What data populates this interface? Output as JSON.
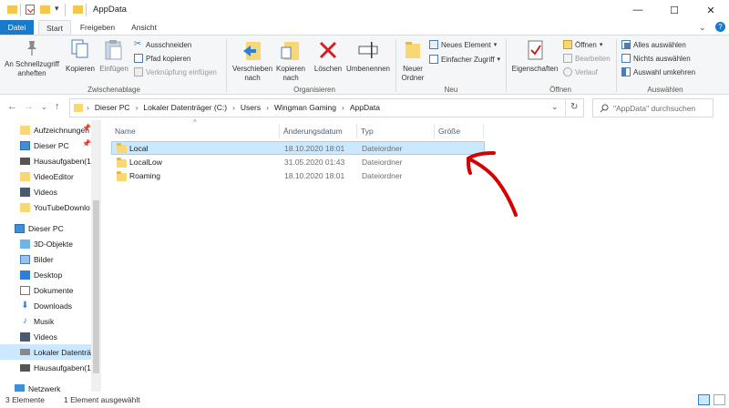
{
  "window": {
    "title": "AppData",
    "minimize": "—",
    "maximize": "☐",
    "close": "✕"
  },
  "ribbon": {
    "tabs": [
      "Datei",
      "Start",
      "Freigeben",
      "Ansicht"
    ],
    "clipboard": {
      "pin_label": "An Schnellzugriff anheften",
      "copy_label": "Kopieren",
      "paste_label": "Einfügen",
      "cut": "Ausschneiden",
      "copy_path": "Pfad kopieren",
      "paste_shortcut": "Verknüpfung einfügen",
      "group_label": "Zwischenablage"
    },
    "organize": {
      "move_label": "Verschieben nach",
      "copyto_label": "Kopieren nach",
      "delete_label": "Löschen",
      "rename_label": "Umbenennen",
      "group_label": "Organisieren"
    },
    "new": {
      "newfolder_label": "Neuer Ordner",
      "newitem": "Neues Element",
      "easyaccess": "Einfacher Zugriff",
      "group_label": "Neu"
    },
    "open": {
      "properties_label": "Eigenschaften",
      "open": "Öffnen",
      "edit": "Bearbeiten",
      "history": "Verlauf",
      "group_label": "Öffnen"
    },
    "select": {
      "select_all": "Alles auswählen",
      "select_none": "Nichts auswählen",
      "invert": "Auswahl umkehren",
      "group_label": "Auswählen"
    }
  },
  "address": {
    "crumbs": [
      "Dieser PC",
      "Lokaler Datenträger (C:)",
      "Users",
      "Wingman Gaming",
      "AppData"
    ],
    "search_placeholder": "\"AppData\" durchsuchen"
  },
  "navpane": {
    "quick": [
      {
        "label": "Aufzeichnungen",
        "pinned": true
      },
      {
        "label": "Dieser PC",
        "pinned": true
      },
      {
        "label": "Hausaufgaben(1",
        "pinned": false
      },
      {
        "label": "VideoEditor",
        "pinned": false
      },
      {
        "label": "Videos",
        "pinned": false
      },
      {
        "label": "YouTubeDownlo",
        "pinned": false
      }
    ],
    "thispc": "Dieser PC",
    "thispc_items": [
      "3D-Objekte",
      "Bilder",
      "Desktop",
      "Dokumente",
      "Downloads",
      "Musik",
      "Videos",
      "Lokaler Datenträ",
      "Hausaufgaben(1"
    ],
    "network": "Netzwerk"
  },
  "filelist": {
    "columns": [
      "Name",
      "Änderungsdatum",
      "Typ",
      "Größe"
    ],
    "rows": [
      {
        "name": "Local",
        "date": "18.10.2020 18:01",
        "type": "Dateiordner",
        "size": "",
        "selected": true
      },
      {
        "name": "LocalLow",
        "date": "31.05.2020 01:43",
        "type": "Dateiordner",
        "size": "",
        "selected": false
      },
      {
        "name": "Roaming",
        "date": "18.10.2020 18:01",
        "type": "Dateiordner",
        "size": "",
        "selected": false
      }
    ]
  },
  "status": {
    "count": "3 Elemente",
    "selection": "1 Element ausgewählt"
  },
  "colors": {
    "accent": "#1979ca",
    "selection": "#cce8ff",
    "annotation": "#d40000"
  }
}
